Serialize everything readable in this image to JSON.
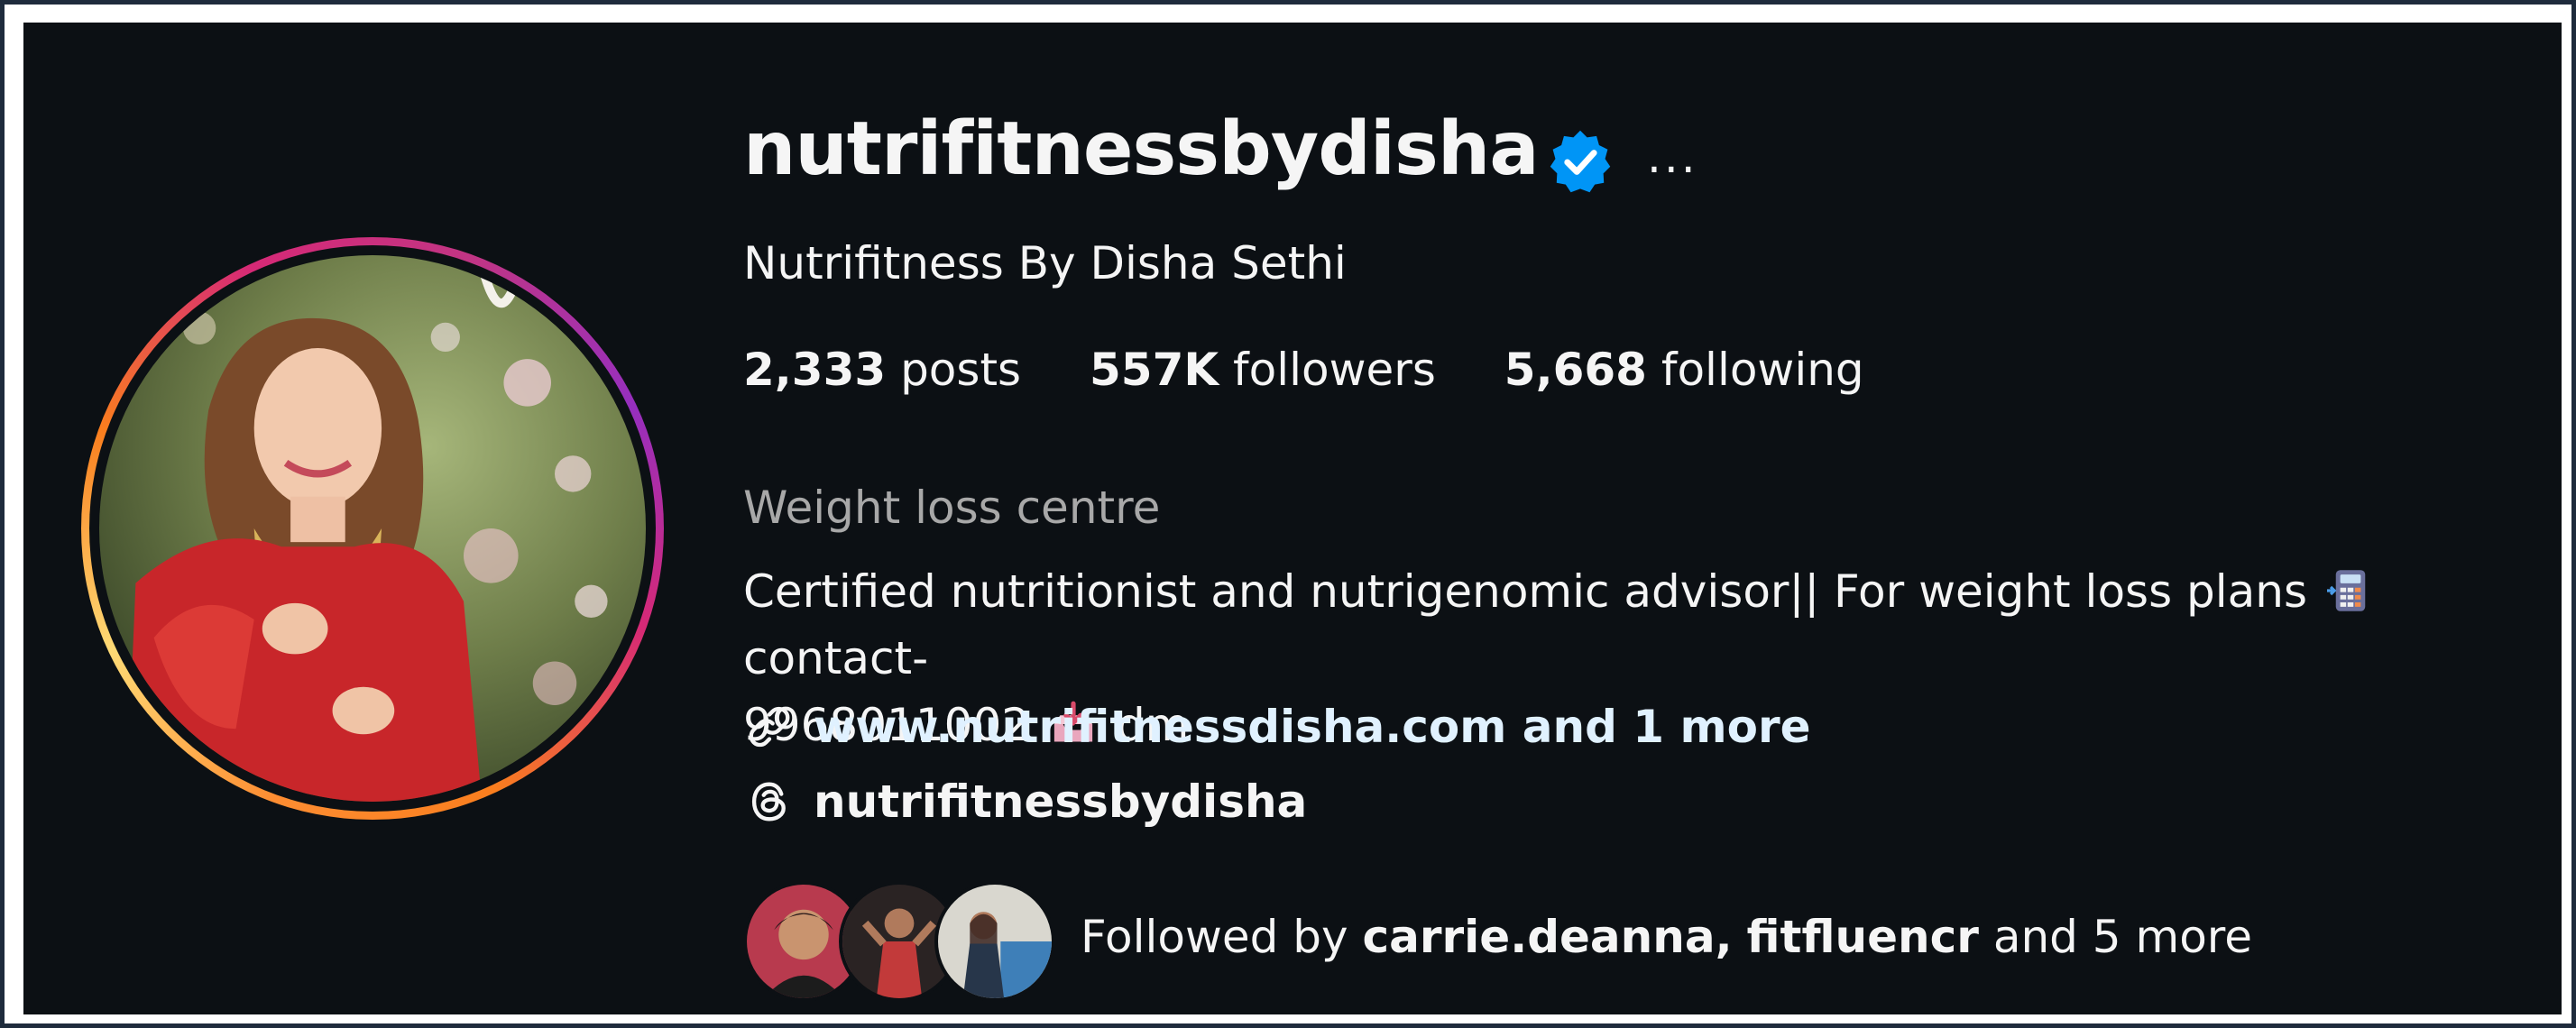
{
  "profile": {
    "username": "nutrifitnessbydisha",
    "full_name": "Nutrifitness By Disha Sethi",
    "more_icon": "...",
    "stats": {
      "posts_count": "2,333",
      "posts_label": "posts",
      "followers_count": "557K",
      "followers_label": "followers",
      "following_count": "5,668",
      "following_label": "following"
    },
    "category": "Weight loss centre",
    "bio": {
      "line1_text": "Certified nutritionist and nutrigenomic advisor|| For weight loss plans",
      "line1_after_emoji": "contact-",
      "line2_text": "9968011002",
      "line2_after_emoji": "dm",
      "emoji1": "calculator-icon",
      "emoji2": "inbox-tray-icon"
    },
    "link": {
      "text": "www.nutrifitnessdisha.com and 1 more",
      "icon": "link-icon"
    },
    "threads": {
      "handle": "nutrifitnessbydisha",
      "icon": "threads-icon"
    },
    "followed_by": {
      "prefix": "Followed by",
      "user1": "carrie.deanna",
      "separator": ",",
      "user2": "fitfluencr",
      "suffix": "and 5 more"
    }
  },
  "colors": {
    "background": "#0c1014",
    "text": "#f5f5f5",
    "muted": "#a8a8a8",
    "verified": "#0095f6",
    "link": "#e0f1ff"
  }
}
